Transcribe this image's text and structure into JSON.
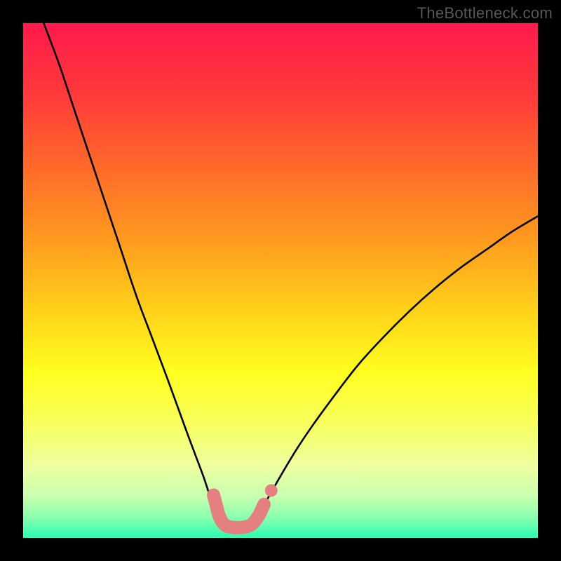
{
  "watermark": "TheBottleneck.com",
  "chart_data": {
    "type": "line",
    "title": "",
    "xlabel": "",
    "ylabel": "",
    "xlim": [
      0,
      1
    ],
    "ylim": [
      0,
      1
    ],
    "background_gradient": {
      "stops": [
        {
          "offset": 0.0,
          "color": "#ff1a4d"
        },
        {
          "offset": 0.14,
          "color": "#ff3a3a"
        },
        {
          "offset": 0.28,
          "color": "#ff6a2a"
        },
        {
          "offset": 0.42,
          "color": "#ff9a1f"
        },
        {
          "offset": 0.56,
          "color": "#ffd21a"
        },
        {
          "offset": 0.68,
          "color": "#ffff20"
        },
        {
          "offset": 0.78,
          "color": "#f7ff60"
        },
        {
          "offset": 0.86,
          "color": "#efffa0"
        },
        {
          "offset": 0.92,
          "color": "#c8ffb0"
        },
        {
          "offset": 0.96,
          "color": "#8affb0"
        },
        {
          "offset": 1.0,
          "color": "#2cffb0"
        }
      ]
    },
    "series": [
      {
        "name": "left-curve",
        "stroke": "#000000",
        "points": [
          {
            "x": 0.04,
            "y": 1.0
          },
          {
            "x": 0.07,
            "y": 0.92
          },
          {
            "x": 0.1,
            "y": 0.83
          },
          {
            "x": 0.13,
            "y": 0.74
          },
          {
            "x": 0.16,
            "y": 0.65
          },
          {
            "x": 0.19,
            "y": 0.56
          },
          {
            "x": 0.22,
            "y": 0.47
          },
          {
            "x": 0.25,
            "y": 0.39
          },
          {
            "x": 0.28,
            "y": 0.31
          },
          {
            "x": 0.3,
            "y": 0.255
          },
          {
            "x": 0.32,
            "y": 0.2
          },
          {
            "x": 0.335,
            "y": 0.16
          },
          {
            "x": 0.35,
            "y": 0.12
          },
          {
            "x": 0.36,
            "y": 0.09
          },
          {
            "x": 0.37,
            "y": 0.06
          },
          {
            "x": 0.38,
            "y": 0.04
          }
        ]
      },
      {
        "name": "right-curve",
        "stroke": "#000000",
        "points": [
          {
            "x": 0.46,
            "y": 0.05
          },
          {
            "x": 0.48,
            "y": 0.085
          },
          {
            "x": 0.5,
            "y": 0.12
          },
          {
            "x": 0.53,
            "y": 0.17
          },
          {
            "x": 0.56,
            "y": 0.215
          },
          {
            "x": 0.6,
            "y": 0.27
          },
          {
            "x": 0.65,
            "y": 0.335
          },
          {
            "x": 0.7,
            "y": 0.39
          },
          {
            "x": 0.75,
            "y": 0.44
          },
          {
            "x": 0.8,
            "y": 0.485
          },
          {
            "x": 0.85,
            "y": 0.525
          },
          {
            "x": 0.9,
            "y": 0.56
          },
          {
            "x": 0.95,
            "y": 0.595
          },
          {
            "x": 1.0,
            "y": 0.625
          }
        ]
      },
      {
        "name": "bottom-overlay",
        "stroke": "#e48080",
        "stroke_width_px": 19,
        "linecap": "round",
        "points": [
          {
            "x": 0.37,
            "y": 0.083
          },
          {
            "x": 0.376,
            "y": 0.06
          },
          {
            "x": 0.382,
            "y": 0.04
          },
          {
            "x": 0.392,
            "y": 0.025
          },
          {
            "x": 0.41,
            "y": 0.02
          },
          {
            "x": 0.43,
            "y": 0.021
          },
          {
            "x": 0.445,
            "y": 0.027
          },
          {
            "x": 0.458,
            "y": 0.044
          },
          {
            "x": 0.468,
            "y": 0.065
          }
        ]
      },
      {
        "name": "right-dot",
        "stroke": "#e48080",
        "type_hint": "dot",
        "radius_px": 9,
        "points": [
          {
            "x": 0.482,
            "y": 0.092
          }
        ]
      }
    ]
  }
}
